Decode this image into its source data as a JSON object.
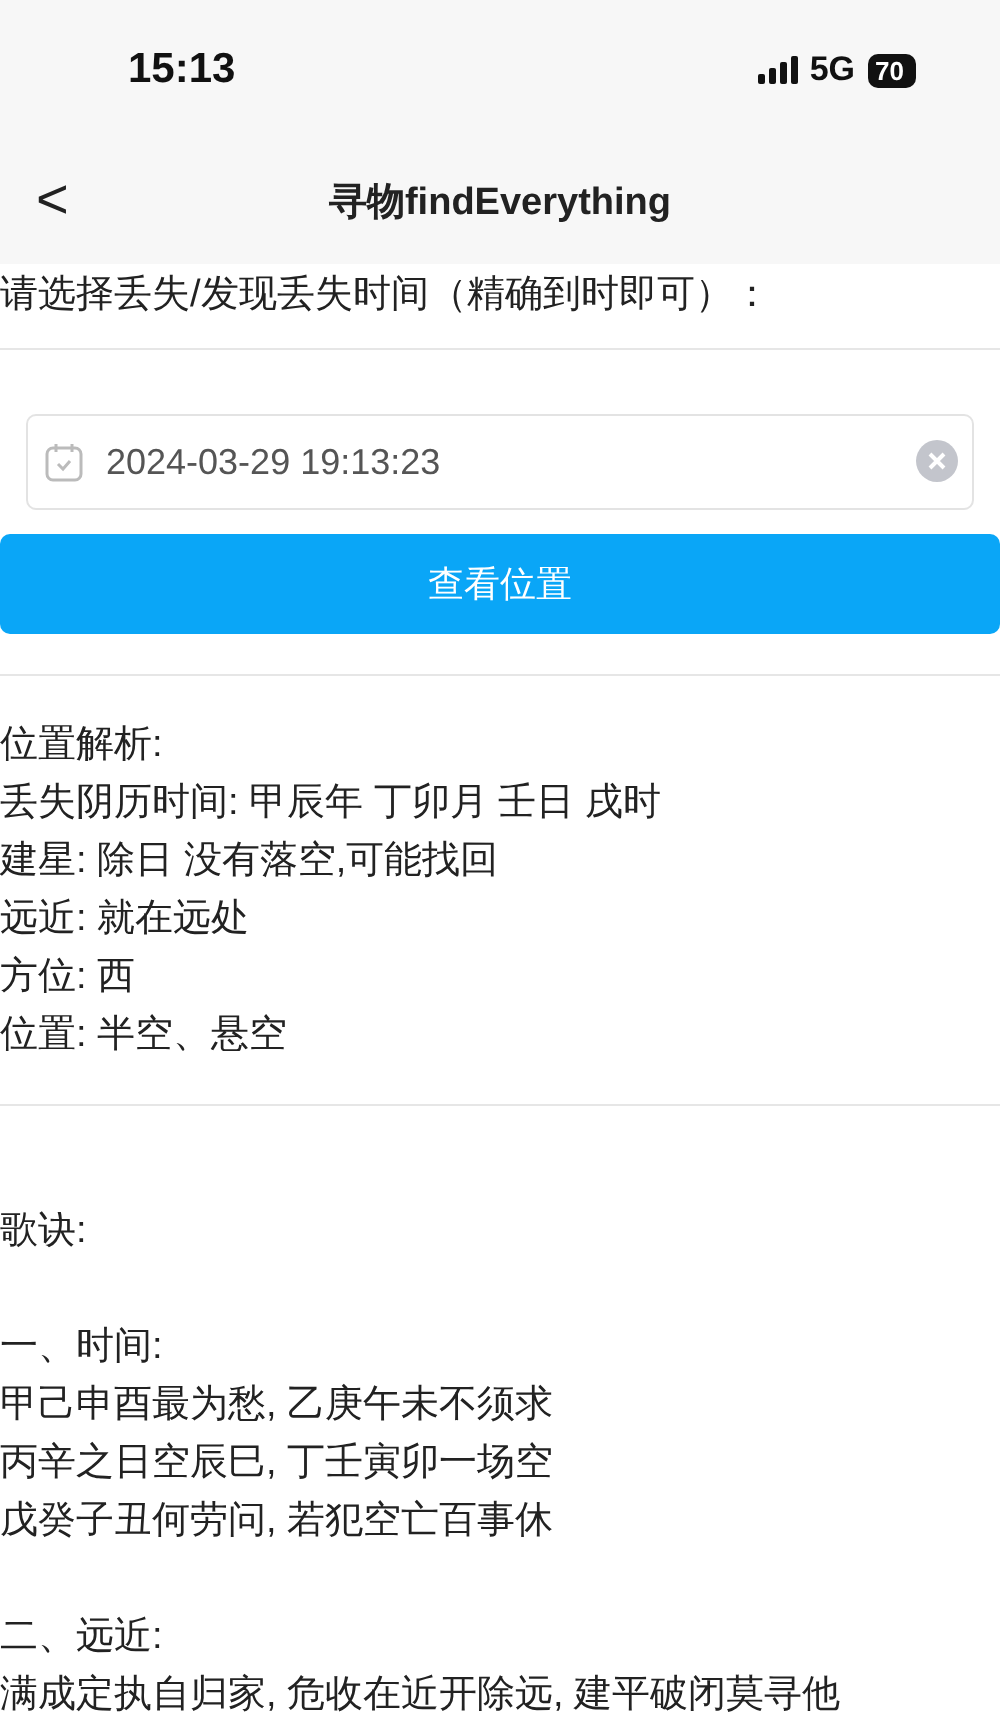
{
  "status_bar": {
    "time": "15:13",
    "network": "5G",
    "battery": "70"
  },
  "nav": {
    "back": "<",
    "title": "寻物findEverything"
  },
  "prompt": "请选择丢失/发现丢失时间（精确到时即可）：",
  "date_field": {
    "value": "2024-03-29 19:13:23"
  },
  "button": "查看位置",
  "analysis": [
    "位置解析:",
    "丢失阴历时间: 甲辰年 丁卯月 壬日 戌时",
    "建星: 除日 没有落空,可能找回",
    "远近: 就在远处",
    "方位: 西",
    "位置: 半空、悬空"
  ],
  "verse": {
    "title": "歌诀:",
    "sections": [
      {
        "heading": "一、时间:",
        "lines": [
          "甲己申酉最为愁, 乙庚午未不须求",
          "丙辛之日空辰巳, 丁壬寅卯一场空",
          "戊癸子丑何劳问, 若犯空亡百事休"
        ]
      },
      {
        "heading": "二、远近:",
        "lines": [
          "满成定执自归家, 危收在近开除远, 建平破闭莫寻他"
        ]
      }
    ]
  }
}
